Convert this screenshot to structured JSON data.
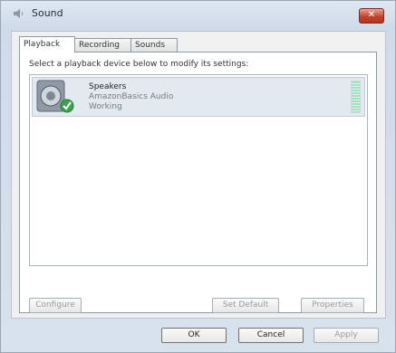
{
  "window": {
    "title": "Sound",
    "close_label": "✕"
  },
  "tabs": [
    {
      "label": "Playback"
    },
    {
      "label": "Recording"
    },
    {
      "label": "Sounds"
    }
  ],
  "playback": {
    "instruction": "Select a playback device below to modify its settings:",
    "devices": [
      {
        "name": "Speakers",
        "driver": "AmazonBasics Audio",
        "status": "Working"
      }
    ]
  },
  "panel_buttons": {
    "configure": "Configure",
    "set_default": "Set Default",
    "properties": "Properties"
  },
  "dialog_buttons": {
    "ok": "OK",
    "cancel": "Cancel",
    "apply": "Apply"
  }
}
